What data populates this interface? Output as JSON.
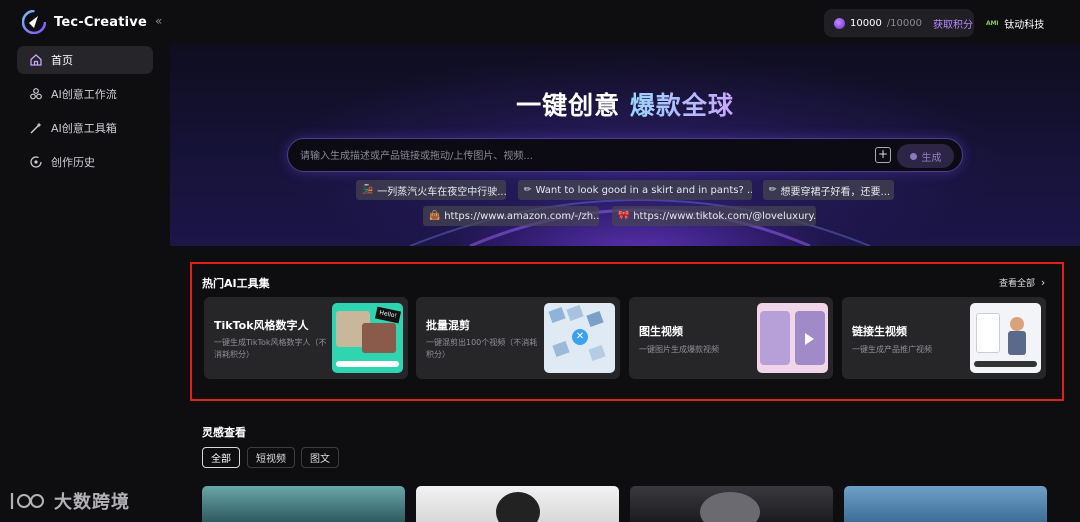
{
  "app": {
    "name": "Tec-Creative",
    "collapse_icon": "«"
  },
  "header": {
    "credits_current": "10000",
    "credits_total": "/10000",
    "get_credits": "获取积分",
    "brand_logo": "AMI",
    "brand_name": "钛动科技"
  },
  "sidebar": {
    "items": [
      {
        "label": "首页",
        "icon": "home-icon",
        "active": true
      },
      {
        "label": "AI创意工作流",
        "icon": "workflow-icon",
        "active": false
      },
      {
        "label": "AI创意工具箱",
        "icon": "magic-wand-icon",
        "active": false
      },
      {
        "label": "创作历史",
        "icon": "history-icon",
        "active": false
      }
    ]
  },
  "hero": {
    "title_part1": "一键创意 ",
    "title_part2": "爆款全球",
    "search_placeholder": "请输入生成描述或产品链接或拖动/上传图片、视频...",
    "add_label": "+",
    "generate_label": "生成",
    "chips": [
      {
        "icon": "🚂",
        "text": "一列蒸汽火车在夜空中行驶..."
      },
      {
        "icon": "✏",
        "text": "Want to look good in a skirt and in pants? ..."
      },
      {
        "icon": "✏",
        "text": "想要穿裙子好看，还要..."
      },
      {
        "icon": "👜",
        "text": "https://www.amazon.com/-/zh..."
      },
      {
        "icon": "🎀",
        "text": "https://www.tiktok.com/@loveluxury..."
      }
    ]
  },
  "tools": {
    "title": "热门AI工具集",
    "see_all": "查看全部",
    "see_all_icon": "chevron-right-icon",
    "cards": [
      {
        "title": "TikTok风格数字人",
        "desc": "一键生成TikTok风格数字人（不消耗积分）"
      },
      {
        "title": "批量混剪",
        "desc": "一键混剪出100个视频（不消耗积分）"
      },
      {
        "title": "图生视频",
        "desc": "一键图片生成爆款视频"
      },
      {
        "title": "链接生视频",
        "desc": "一键生成产品推广视频"
      }
    ],
    "thumb_text": {
      "hello": "Hello!"
    }
  },
  "inspiration": {
    "title": "灵感查看",
    "filters": [
      {
        "label": "全部",
        "active": true
      },
      {
        "label": "短视频",
        "active": false
      },
      {
        "label": "图文",
        "active": false
      }
    ]
  },
  "watermark": {
    "text": "大数跨境",
    "logo": "100"
  },
  "colors": {
    "accent": "#8b5cf6",
    "highlight_box": "#e0201b",
    "background": "#0e0e10",
    "card": "#262629"
  }
}
